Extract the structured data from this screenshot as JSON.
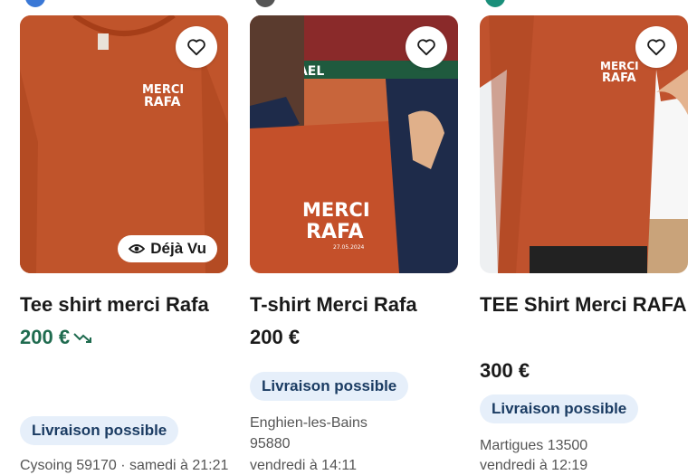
{
  "listings": [
    {
      "title": "Tee shirt merci Rafa",
      "price": "200 €",
      "seen_label": "Déjà Vu",
      "badge": "Livraison possible",
      "location_cut": "Cysoing 59170 · samedi à 21:21",
      "shirt_print_line1": "MERCI",
      "shirt_print_line2": "RAFA"
    },
    {
      "title": "T-shirt Merci Rafa",
      "price": "200 €",
      "badge": "Livraison possible",
      "location_line1": "Enghien-les-Bains",
      "location_line2": "95880",
      "location_cut": "vendredi à 14:11",
      "banner_text": "FAEL",
      "shirt_print_line1": "MERCI",
      "shirt_print_line2": "RAFA",
      "shirt_print_date": "27.05.2024"
    },
    {
      "title": "TEE Shirt Merci RAFA",
      "price": "300 €",
      "badge": "Livraison possible",
      "location_line1": "Martigues 13500",
      "location_cut": "vendredi à 12:19",
      "shirt_print_line1": "MERCI",
      "shirt_print_line2": "RAFA"
    }
  ],
  "colors": {
    "price_drop": "#1f6b4f",
    "badge_bg": "#e6effa",
    "badge_text": "#1b3c63",
    "shirt": "#c0522d"
  },
  "icons": {
    "favorite": "heart-icon",
    "seen": "eye-icon",
    "price_drop": "trend-down-icon"
  }
}
